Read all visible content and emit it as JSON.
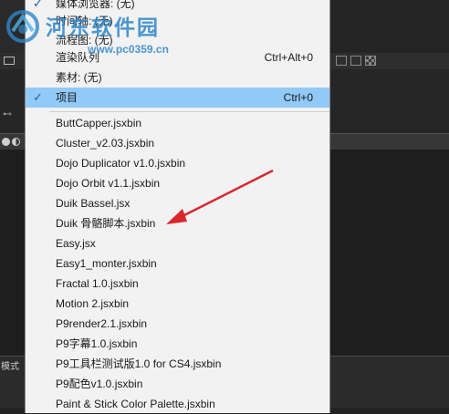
{
  "watermark": {
    "title": "河东软件园",
    "url": "www.pc0359.cn"
  },
  "background_panel": {
    "mode_label": "模式"
  },
  "menu": {
    "items": [
      {
        "label": "媒体浏览器: (无)",
        "shortcut": "",
        "checked": true,
        "selected": false
      },
      {
        "label": "时间轴: (无)",
        "shortcut": "",
        "checked": false,
        "selected": false
      },
      {
        "label": "流程图: (无)",
        "shortcut": "",
        "checked": false,
        "selected": false
      },
      {
        "label": "渲染队列",
        "shortcut": "Ctrl+Alt+0",
        "checked": false,
        "selected": false
      },
      {
        "label": "素材: (无)",
        "shortcut": "",
        "checked": false,
        "selected": false
      },
      {
        "label": "项目",
        "shortcut": "Ctrl+0",
        "checked": true,
        "selected": true
      }
    ],
    "scripts": [
      "ButtCapper.jsxbin",
      "Cluster_v2.03.jsxbin",
      "Dojo Duplicator v1.0.jsxbin",
      "Dojo Orbit v1.1.jsxbin",
      "Duik Bassel.jsx",
      "Duik 骨骼脚本.jsxbin",
      "Easy.jsx",
      "Easy1_monter.jsxbin",
      "Fractal 1.0.jsxbin",
      "Motion 2.jsxbin",
      "P9render2.1.jsxbin",
      "P9字幕1.0.jsxbin",
      "P9工具栏测试版1.0 for CS4.jsxbin",
      "P9配色v1.0.jsxbin",
      "Paint & Stick Color Palette.jsxbin"
    ]
  },
  "colors": {
    "menu_bg": "#f2f2f2",
    "selection": "#91c9f7",
    "arrow": "#d9262b",
    "watermark": "#2f86c9"
  }
}
